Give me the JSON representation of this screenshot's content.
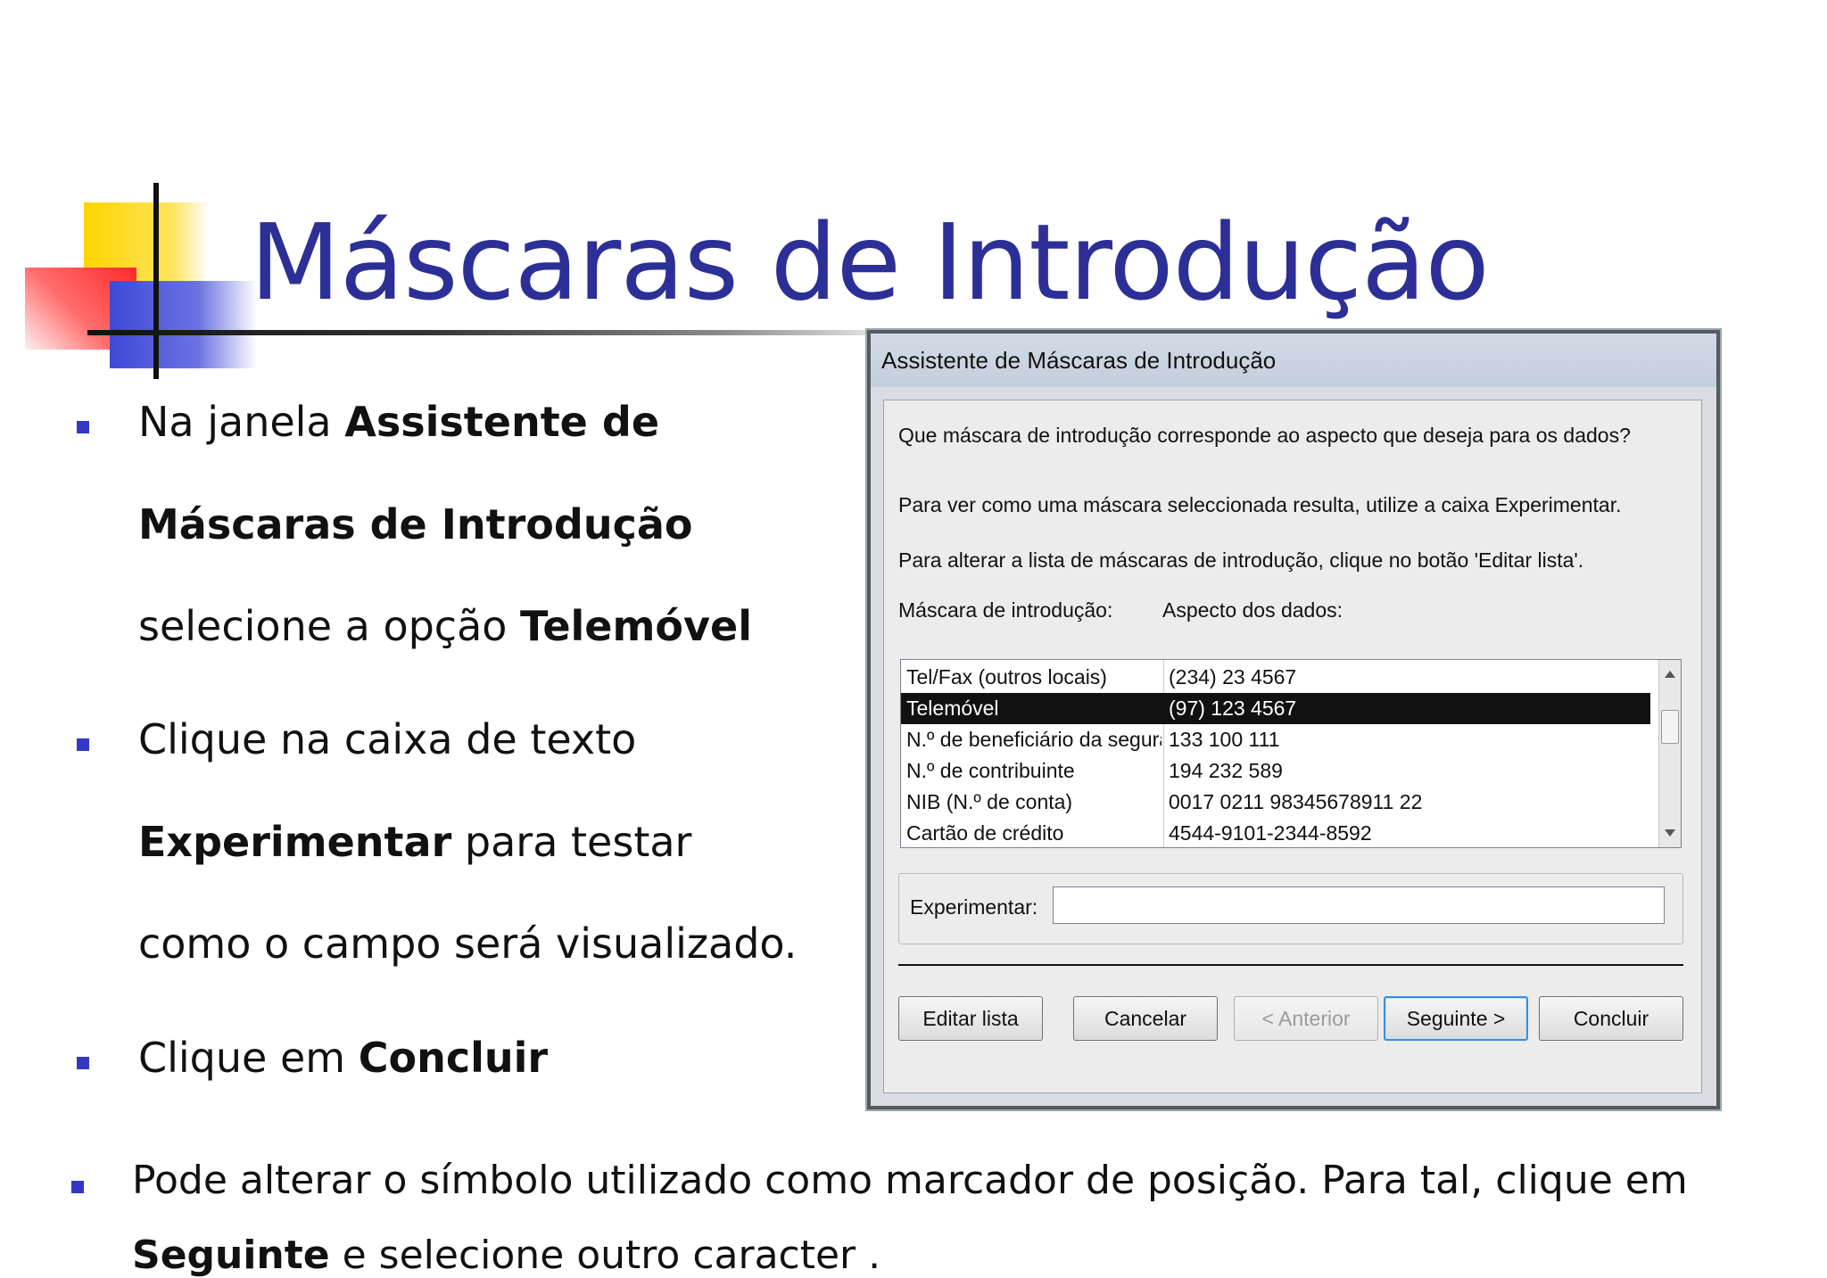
{
  "slide": {
    "title": "Máscaras de Introdução",
    "bullets": [
      {
        "l1a": "Na janela ",
        "l1b": "Assistente de",
        "l2b": "Máscaras de Introdução",
        "l3a": "selecione a opção ",
        "l3b": "Telemóvel"
      },
      {
        "l1a": "Clique na caixa de texto",
        "l2b": "Experimentar",
        "l2a": " para testar",
        "l3a": "como o campo será visualizado."
      },
      {
        "l1a": "Clique em ",
        "l1b": "Concluir"
      },
      {
        "l1a": "Pode alterar o símbolo utilizado como marcador de posição. Para tal, clique em",
        "l2b": "Seguinte",
        "l2a": " e selecione outro caracter ."
      }
    ]
  },
  "dialog": {
    "title": "Assistente de Máscaras de Introdução",
    "question": "Que máscara de introdução corresponde ao aspecto que deseja para os dados?",
    "hint1": "Para ver como uma máscara seleccionada resulta, utilize a caixa Experimentar.",
    "hint2": "Para alterar a lista de máscaras de introdução, clique no botão 'Editar lista'.",
    "col1_header": "Máscara de introdução:",
    "col2_header": "Aspecto dos dados:",
    "rows": [
      {
        "mask": "Tel/Fax (outros locais)",
        "sample": "(234) 23 4567"
      },
      {
        "mask": "Telemóvel",
        "sample": "(97) 123 4567"
      },
      {
        "mask": "N.º de beneficiário da segurança s",
        "sample": "133 100 111"
      },
      {
        "mask": "N.º de contribuinte",
        "sample": "194 232 589"
      },
      {
        "mask": "NIB (N.º de conta)",
        "sample": "0017 0211 98345678911 22"
      },
      {
        "mask": "Cartão de crédito",
        "sample": "4544-9101-2344-8592"
      }
    ],
    "try_label": "Experimentar:",
    "try_value": "",
    "buttons": {
      "edit": "Editar lista",
      "cancel": "Cancelar",
      "back": "< Anterior",
      "next": "Seguinte >",
      "finish": "Concluir"
    }
  }
}
